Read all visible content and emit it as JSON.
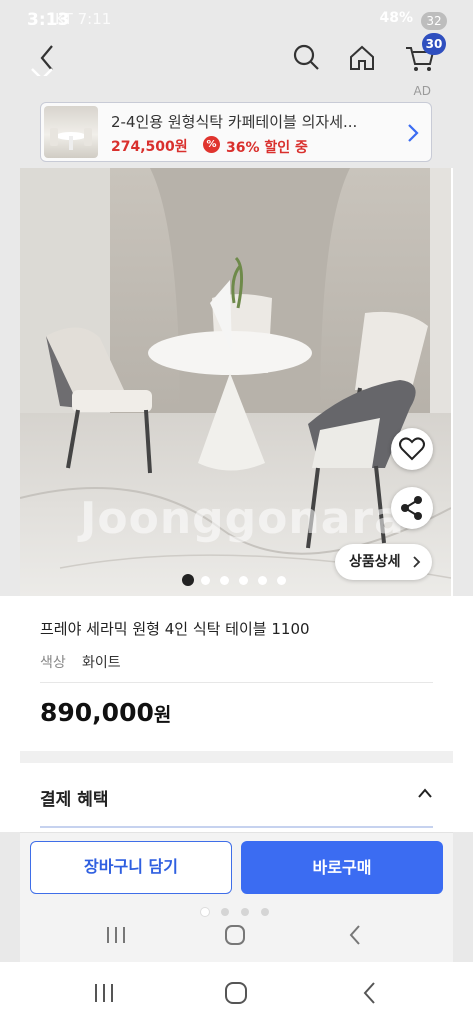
{
  "status_bar": {
    "time": "3:13",
    "carrier": "KT 7:11",
    "battery": "48%",
    "notification_count": "32"
  },
  "nav": {
    "cart_count": "30"
  },
  "ad": {
    "label": "AD",
    "title": "2-4인용 원형식탁 카페테이블 의자세...",
    "price": "274,500원",
    "discount": "36% 할인 중",
    "discount_icon": "%"
  },
  "image": {
    "watermark": "Joonggonara",
    "detail_button": "상품상세",
    "dot_count": 6,
    "active_dot": 0
  },
  "product": {
    "title": "프레야 세라믹 원형 4인 식탁 테이블 1100",
    "option_label": "색상",
    "option_value": "화이트",
    "price": "890,000",
    "price_unit": "원"
  },
  "benefit": {
    "title": "결제 혜택"
  },
  "actions": {
    "cart_label": "장바구니 담기",
    "buy_label": "바로구매"
  },
  "colors": {
    "primary": "#3b6cf2",
    "sale": "#d9302d",
    "badge": "#2f4fbf"
  },
  "icons": [
    "back-icon",
    "search-icon",
    "home-icon",
    "cart-icon",
    "close-icon",
    "heart-icon",
    "share-icon",
    "chevron-up-icon",
    "recents-icon",
    "home-circle-icon",
    "system-back-icon"
  ]
}
